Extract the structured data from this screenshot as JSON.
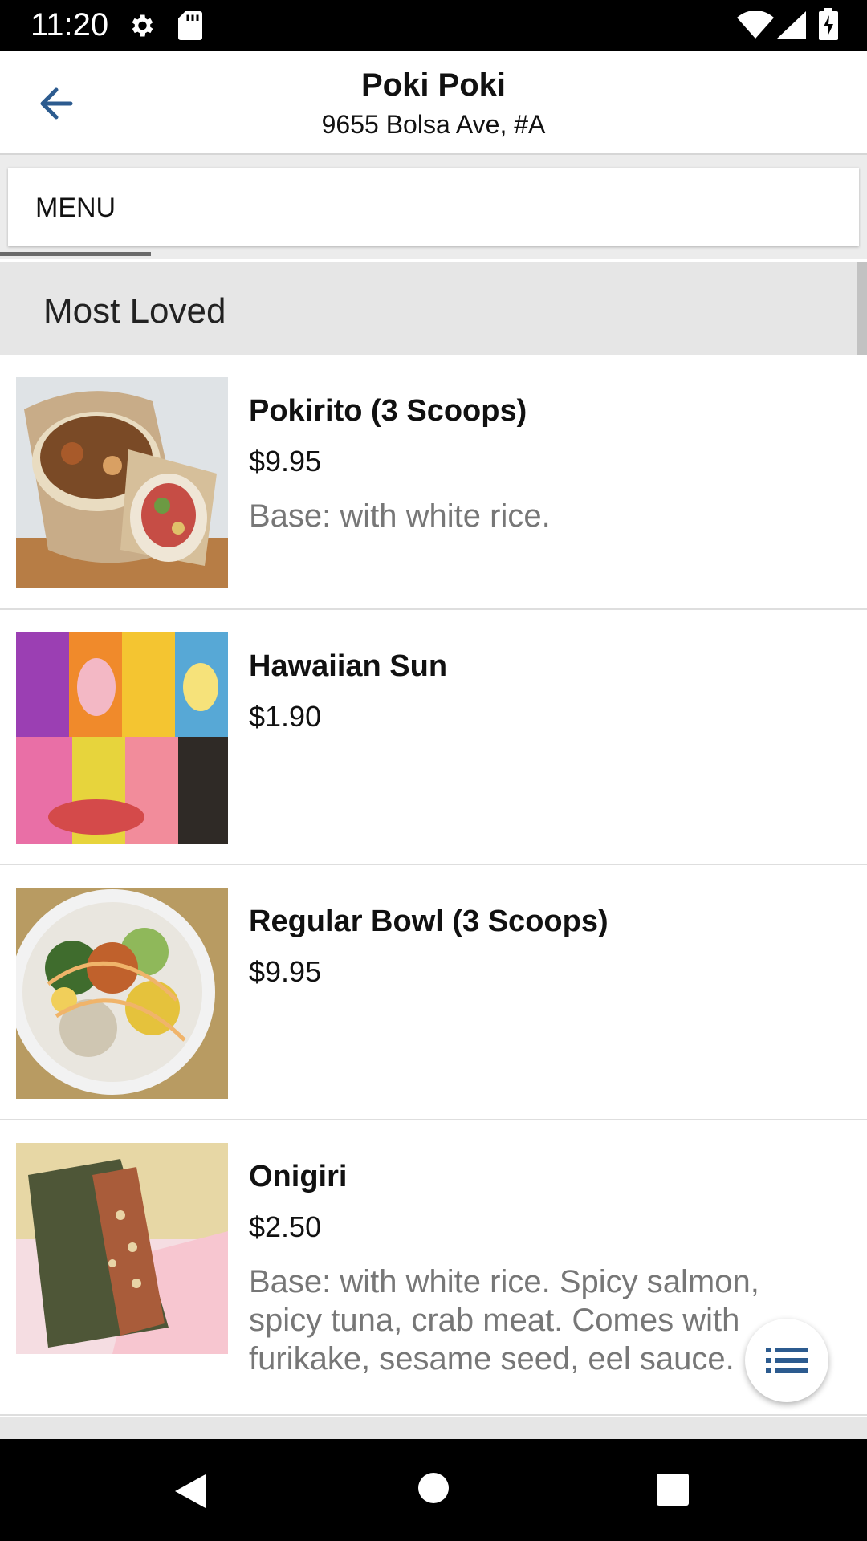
{
  "status_bar": {
    "time": "11:20",
    "icons": [
      "gear-icon",
      "sd-card-icon",
      "wifi-icon",
      "cell-signal-icon",
      "battery-icon"
    ]
  },
  "app_bar": {
    "title": "Poki Poki",
    "subtitle": "9655 Bolsa Ave, #A",
    "back_icon": "arrow-left-icon",
    "accent_color": "#2c5b8f"
  },
  "tabs": [
    {
      "label": "MENU",
      "selected": true
    }
  ],
  "section": {
    "title": "Most Loved"
  },
  "items": [
    {
      "name": "Pokirito (3 Scoops)",
      "price": "$9.95",
      "description": "Base: with white rice.",
      "image": "pokirito-photo"
    },
    {
      "name": "Hawaiian Sun",
      "price": "$1.90",
      "description": "",
      "image": "hawaiian-sun-cans-photo"
    },
    {
      "name": "Regular Bowl (3 Scoops)",
      "price": "$9.95",
      "description": "",
      "image": "poke-bowl-photo"
    },
    {
      "name": "Onigiri",
      "price": "$2.50",
      "description": "Base: with white rice. Spicy salmon, spicy tuna, crab meat. Comes with furikake, sesame seed, eel sauce.",
      "image": "onigiri-photo"
    }
  ],
  "fab": {
    "icon": "list-icon"
  },
  "nav_bar": {
    "icons": [
      "back-triangle-icon",
      "home-circle-icon",
      "recents-square-icon"
    ]
  }
}
